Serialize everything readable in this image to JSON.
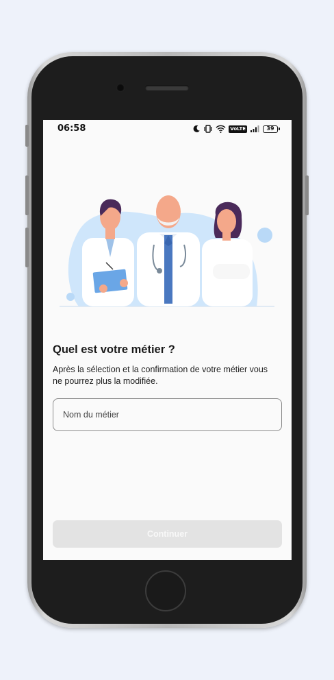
{
  "status_bar": {
    "time": "06:58",
    "network": "VoLTE",
    "battery": "39"
  },
  "icons": [
    "moon-icon",
    "vibrate-icon",
    "wifi-icon",
    "volte-icon",
    "signal-icon",
    "battery-icon"
  ],
  "main": {
    "title": "Quel est votre métier ?",
    "description": "Après la sélection et la confirmation de votre métier vous ne pourrez plus la modifiée."
  },
  "job_input": {
    "placeholder": "Nom du métier",
    "value": ""
  },
  "continue_button": {
    "label": "Continuer",
    "enabled": false
  },
  "colors": {
    "page_background": "#eef2fa",
    "screen_background": "#fafafa",
    "illustration_blob": "#cfe6fb",
    "coat": "#ffffff",
    "hair_dark": "#4a2a5a",
    "tie": "#4a78c0",
    "button_disabled": "#e3e3e3"
  }
}
